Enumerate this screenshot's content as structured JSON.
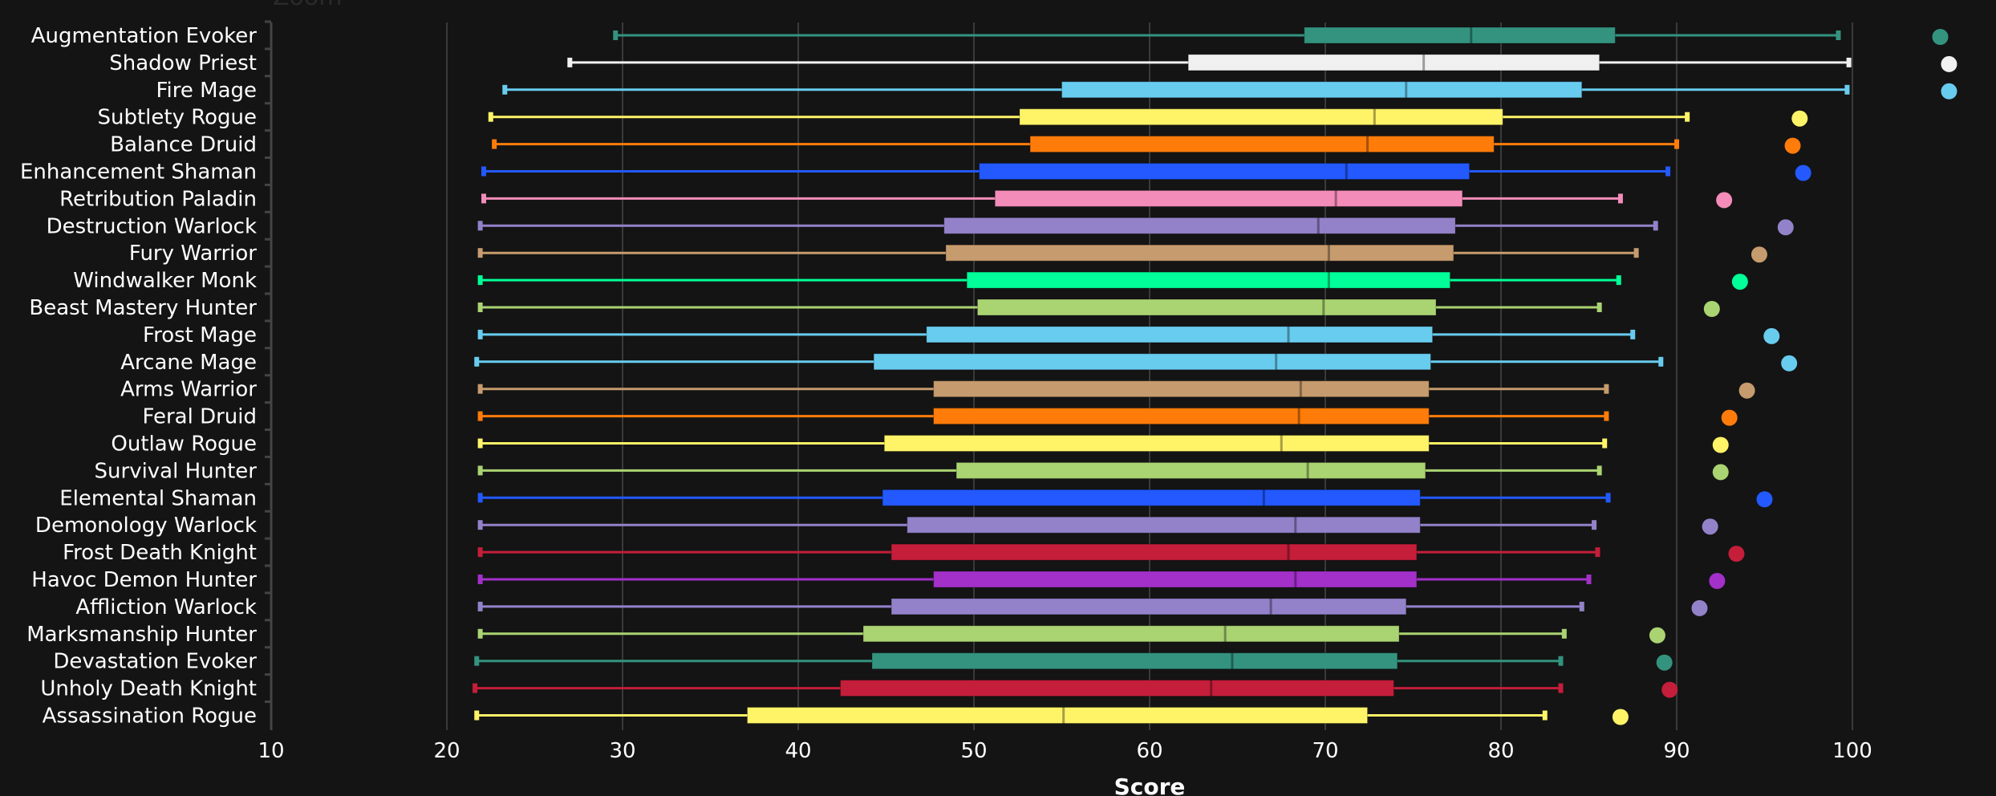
{
  "chart_data": {
    "type": "boxplot",
    "title": "Zoom",
    "xlabel": "Score",
    "ylabel": "",
    "xlim": [
      10,
      100
    ],
    "xticks": [
      10,
      20,
      30,
      40,
      50,
      60,
      70,
      80,
      90,
      100
    ],
    "grid": true,
    "legend": "none",
    "series": [
      {
        "name": "Augmentation Evoker",
        "color": "#33937f",
        "min": 29.6,
        "q1": 68.8,
        "median": 78.3,
        "q3": 86.5,
        "max": 99.2,
        "point": 105.0
      },
      {
        "name": "Shadow Priest",
        "color": "#f0f0f0",
        "min": 27.0,
        "q1": 62.2,
        "median": 75.6,
        "q3": 85.6,
        "max": 99.8,
        "point": 105.5
      },
      {
        "name": "Fire Mage",
        "color": "#68ccef",
        "min": 23.3,
        "q1": 55.0,
        "median": 74.6,
        "q3": 84.6,
        "max": 99.7,
        "point": 105.5
      },
      {
        "name": "Subtlety Rogue",
        "color": "#fff468",
        "min": 22.5,
        "q1": 52.6,
        "median": 72.8,
        "q3": 80.1,
        "max": 90.6,
        "point": 97.0
      },
      {
        "name": "Balance Druid",
        "color": "#ff7c0a",
        "min": 22.7,
        "q1": 53.2,
        "median": 72.4,
        "q3": 79.6,
        "max": 90.0,
        "point": 96.6
      },
      {
        "name": "Enhancement Shaman",
        "color": "#2359ff",
        "min": 22.1,
        "q1": 50.3,
        "median": 71.2,
        "q3": 78.2,
        "max": 89.5,
        "point": 97.2
      },
      {
        "name": "Retribution Paladin",
        "color": "#f48cba",
        "min": 22.1,
        "q1": 51.2,
        "median": 70.6,
        "q3": 77.8,
        "max": 86.8,
        "point": 92.7
      },
      {
        "name": "Destruction Warlock",
        "color": "#9382c9",
        "min": 21.9,
        "q1": 48.3,
        "median": 69.6,
        "q3": 77.4,
        "max": 88.8,
        "point": 96.2
      },
      {
        "name": "Fury Warrior",
        "color": "#c69b6d",
        "min": 21.9,
        "q1": 48.4,
        "median": 70.2,
        "q3": 77.3,
        "max": 87.7,
        "point": 94.7
      },
      {
        "name": "Windwalker Monk",
        "color": "#00ff98",
        "min": 21.9,
        "q1": 49.6,
        "median": 70.2,
        "q3": 77.1,
        "max": 86.7,
        "point": 93.6
      },
      {
        "name": "Beast Mastery Hunter",
        "color": "#aad372",
        "min": 21.9,
        "q1": 50.2,
        "median": 69.9,
        "q3": 76.3,
        "max": 85.6,
        "point": 92.0
      },
      {
        "name": "Frost Mage",
        "color": "#68ccef",
        "min": 21.9,
        "q1": 47.3,
        "median": 67.9,
        "q3": 76.1,
        "max": 87.5,
        "point": 95.4
      },
      {
        "name": "Arcane Mage",
        "color": "#68ccef",
        "min": 21.7,
        "q1": 44.3,
        "median": 67.2,
        "q3": 76.0,
        "max": 89.1,
        "point": 96.4
      },
      {
        "name": "Arms Warrior",
        "color": "#c69b6d",
        "min": 21.9,
        "q1": 47.7,
        "median": 68.6,
        "q3": 75.9,
        "max": 86.0,
        "point": 94.0
      },
      {
        "name": "Feral Druid",
        "color": "#ff7c0a",
        "min": 21.9,
        "q1": 47.7,
        "median": 68.5,
        "q3": 75.9,
        "max": 86.0,
        "point": 93.0
      },
      {
        "name": "Outlaw Rogue",
        "color": "#fff468",
        "min": 21.9,
        "q1": 44.9,
        "median": 67.5,
        "q3": 75.9,
        "max": 85.9,
        "point": 92.5
      },
      {
        "name": "Survival Hunter",
        "color": "#aad372",
        "min": 21.9,
        "q1": 49.0,
        "median": 69.0,
        "q3": 75.7,
        "max": 85.6,
        "point": 92.5
      },
      {
        "name": "Elemental Shaman",
        "color": "#2359ff",
        "min": 21.9,
        "q1": 44.8,
        "median": 66.5,
        "q3": 75.4,
        "max": 86.1,
        "point": 95.0
      },
      {
        "name": "Demonology Warlock",
        "color": "#9382c9",
        "min": 21.9,
        "q1": 46.2,
        "median": 68.3,
        "q3": 75.4,
        "max": 85.3,
        "point": 91.9
      },
      {
        "name": "Frost Death Knight",
        "color": "#c41e3a",
        "min": 21.9,
        "q1": 45.3,
        "median": 67.9,
        "q3": 75.2,
        "max": 85.5,
        "point": 93.4
      },
      {
        "name": "Havoc Demon Hunter",
        "color": "#a330c9",
        "min": 21.9,
        "q1": 47.7,
        "median": 68.3,
        "q3": 75.2,
        "max": 85.0,
        "point": 92.3
      },
      {
        "name": "Affliction Warlock",
        "color": "#9382c9",
        "min": 21.9,
        "q1": 45.3,
        "median": 66.9,
        "q3": 74.6,
        "max": 84.6,
        "point": 91.3
      },
      {
        "name": "Marksmanship Hunter",
        "color": "#aad372",
        "min": 21.9,
        "q1": 43.7,
        "median": 64.3,
        "q3": 74.2,
        "max": 83.6,
        "point": 88.9
      },
      {
        "name": "Devastation Evoker",
        "color": "#33937f",
        "min": 21.7,
        "q1": 44.2,
        "median": 64.7,
        "q3": 74.1,
        "max": 83.4,
        "point": 89.3
      },
      {
        "name": "Unholy Death Knight",
        "color": "#c41e3a",
        "min": 21.6,
        "q1": 42.4,
        "median": 63.5,
        "q3": 73.9,
        "max": 83.4,
        "point": 89.6
      },
      {
        "name": "Assassination Rogue",
        "color": "#fff468",
        "min": 21.7,
        "q1": 37.1,
        "median": 55.1,
        "q3": 72.4,
        "max": 82.5,
        "point": 86.8
      }
    ]
  }
}
